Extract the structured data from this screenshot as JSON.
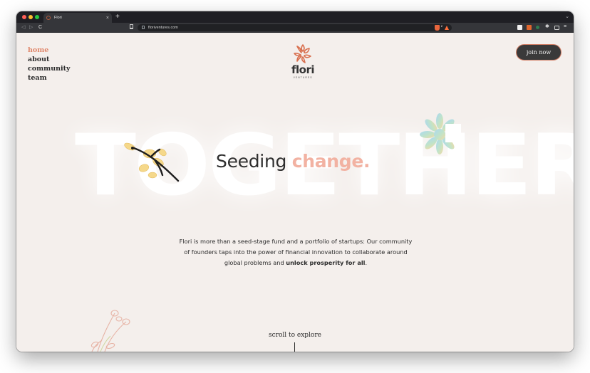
{
  "browser": {
    "tab_title": "Flori",
    "tab_close": "×",
    "new_tab": "+",
    "tab_search": "⌄",
    "url": "floriventures.com",
    "shield_count": "2",
    "nav_back": "◁",
    "nav_forward": "▷",
    "nav_reload": "C",
    "ext_puzzle": "✱",
    "ext_menu": "≡"
  },
  "site": {
    "nav": [
      {
        "label": "home",
        "active": true
      },
      {
        "label": "about",
        "active": false
      },
      {
        "label": "community",
        "active": false
      },
      {
        "label": "team",
        "active": false
      }
    ],
    "logo_word": "flori",
    "logo_sub": "VENTURES",
    "join_label": "join now",
    "big_word": "TOGETHER",
    "headline_prefix": "Seeding ",
    "headline_accent": "change.",
    "description_lead": "Flori is more than a seed-stage fund and a portfolio of startups: Our community of founders taps into the power of financial innovation to collaborate around global problems and ",
    "description_bold": "unlock prosperity for all",
    "description_end": ".",
    "scroll_label": "scroll to explore"
  },
  "colors": {
    "accent": "#e0866a",
    "headline_accent": "#f2b2a2",
    "button_bg": "#3a3a3a",
    "page_bg": "#f4efec"
  }
}
